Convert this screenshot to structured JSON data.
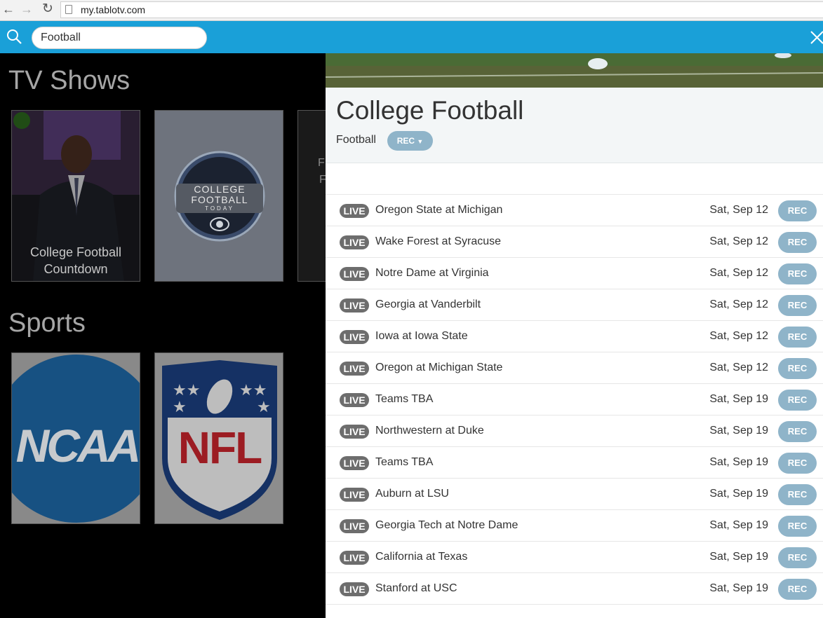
{
  "browser": {
    "url": "my.tablotv.com"
  },
  "search": {
    "value": "Football"
  },
  "sections": {
    "tv_shows": {
      "title": "TV Shows",
      "tiles": [
        {
          "caption_line1": "College Football",
          "caption_line2": "Countdown"
        },
        {
          "logo_line1": "COLLEGE",
          "logo_line2": "FOOTBALL",
          "logo_line3": "TODAY"
        },
        {
          "partial_text1": "F",
          "partial_text2": "F"
        }
      ]
    },
    "sports": {
      "title": "Sports",
      "tiles": [
        {
          "logo": "NCAA"
        },
        {
          "logo": "NFL"
        }
      ]
    }
  },
  "detail": {
    "title": "College Football",
    "genre": "Football",
    "rec_label": "REC",
    "episodes": [
      {
        "badge": "LIVE",
        "title": "Oregon State at Michigan",
        "date": "Sat, Sep 12",
        "rec": "REC"
      },
      {
        "badge": "LIVE",
        "title": "Wake Forest at Syracuse",
        "date": "Sat, Sep 12",
        "rec": "REC"
      },
      {
        "badge": "LIVE",
        "title": "Notre Dame at Virginia",
        "date": "Sat, Sep 12",
        "rec": "REC"
      },
      {
        "badge": "LIVE",
        "title": "Georgia at Vanderbilt",
        "date": "Sat, Sep 12",
        "rec": "REC"
      },
      {
        "badge": "LIVE",
        "title": "Iowa at Iowa State",
        "date": "Sat, Sep 12",
        "rec": "REC"
      },
      {
        "badge": "LIVE",
        "title": "Oregon at Michigan State",
        "date": "Sat, Sep 12",
        "rec": "REC"
      },
      {
        "badge": "LIVE",
        "title": "Teams TBA",
        "date": "Sat, Sep 19",
        "rec": "REC"
      },
      {
        "badge": "LIVE",
        "title": "Northwestern at Duke",
        "date": "Sat, Sep 19",
        "rec": "REC"
      },
      {
        "badge": "LIVE",
        "title": "Teams TBA",
        "date": "Sat, Sep 19",
        "rec": "REC"
      },
      {
        "badge": "LIVE",
        "title": "Auburn at LSU",
        "date": "Sat, Sep 19",
        "rec": "REC"
      },
      {
        "badge": "LIVE",
        "title": "Georgia Tech at Notre Dame",
        "date": "Sat, Sep 19",
        "rec": "REC"
      },
      {
        "badge": "LIVE",
        "title": "California at Texas",
        "date": "Sat, Sep 19",
        "rec": "REC"
      },
      {
        "badge": "LIVE",
        "title": "Stanford at USC",
        "date": "Sat, Sep 19",
        "rec": "REC"
      }
    ]
  },
  "colors": {
    "search_bar": "#1aa0d8",
    "rec_button": "#8fb4c9",
    "live_badge": "#6d6d6d"
  }
}
